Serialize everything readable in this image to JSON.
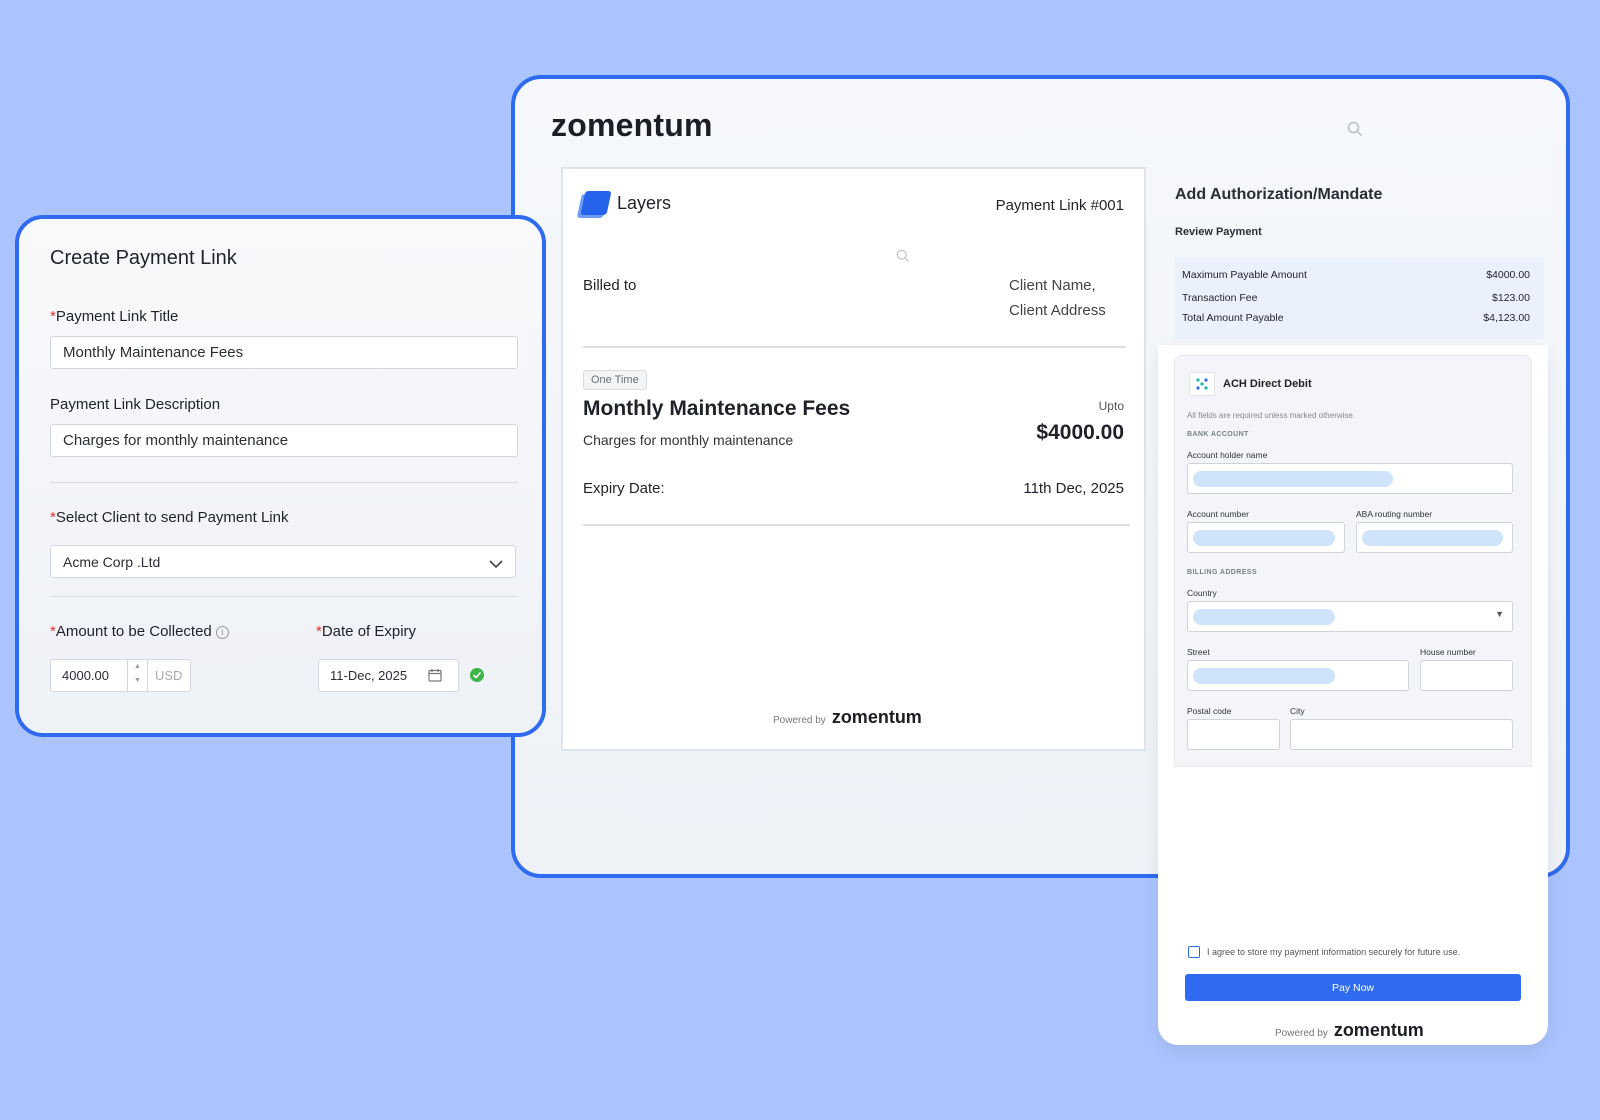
{
  "brand": {
    "logo_text": "zomentum"
  },
  "invoice": {
    "company_name": "Layers",
    "link_number": "Payment Link #001",
    "billed_to_label": "Billed to",
    "client_name": "Client Name,",
    "client_address": "Client Address",
    "badge": "One Time",
    "title": "Monthly Maintenance Fees",
    "description": "Charges for monthly maintenance",
    "upto_label": "Upto",
    "amount": "$4000.00",
    "expiry_label": "Expiry Date:",
    "expiry_value": "11th Dec, 2025",
    "powered_by": "Powered by",
    "powered_logo": "zomentum"
  },
  "authorization": {
    "title": "Add Authorization/Mandate",
    "review_label": "Review Payment",
    "rows": [
      {
        "label": "Maximum Payable Amount",
        "value": "$4000.00"
      },
      {
        "label": "Transaction Fee",
        "value": "$123.00"
      },
      {
        "label": "Total Amount Payable",
        "value": "$4,123.00"
      }
    ]
  },
  "payment_form": {
    "method_title": "ACH Direct Debit",
    "note": "All fields are required unless marked otherwise.",
    "bank_section": "BANK ACCOUNT",
    "account_holder_label": "Account holder name",
    "account_number_label": "Account number",
    "routing_label": "ABA routing number",
    "billing_section": "BILLING ADDRESS",
    "country_label": "Country",
    "street_label": "Street",
    "house_label": "House number",
    "postal_label": "Postal code",
    "city_label": "City",
    "agree_text": "I agree to store my payment information securely for future use.",
    "pay_button": "Pay Now",
    "powered_by": "Powered by",
    "powered_logo": "zomentum"
  },
  "create_link": {
    "title": "Create Payment Link",
    "required_mark": "*",
    "link_title_label": "Payment Link Title",
    "link_title_value": "Monthly Maintenance Fees",
    "description_label": "Payment Link Description",
    "description_value": "Charges for monthly maintenance",
    "client_label": "Select Client to send Payment Link",
    "client_value": "Acme Corp .Ltd",
    "amount_label": "Amount to be Collected",
    "amount_value": "4000.00",
    "currency": "USD",
    "expiry_label": "Date of Expiry",
    "expiry_value": "11-Dec, 2025"
  },
  "colors": {
    "accent": "#2f6bf0",
    "background": "#abc4fe",
    "success": "#3bb54a",
    "required": "#e5322d"
  }
}
